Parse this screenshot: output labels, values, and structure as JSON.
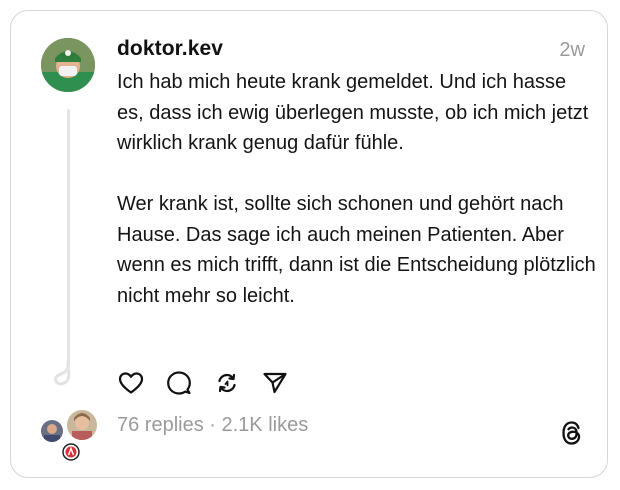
{
  "post": {
    "username": "doktor.kev",
    "timestamp": "2w",
    "paragraph_1": "Ich hab mich heute krank gemeldet. Und ich hasse es, dass ich ewig überlegen musste, ob ich mich jetzt wirklich krank genug dafür fühle.",
    "paragraph_2": "Wer krank ist, sollte sich schonen und gehört nach Hause. Das sage ich auch meinen Patienten. Aber wenn es mich trifft, dann ist die Entscheidung plötzlich nicht mehr so leicht."
  },
  "actions": [
    {
      "name": "like",
      "icon": "heart-icon"
    },
    {
      "name": "reply",
      "icon": "comment-icon"
    },
    {
      "name": "repost",
      "icon": "repost-icon"
    },
    {
      "name": "share",
      "icon": "send-icon"
    }
  ],
  "stats": {
    "summary": "76 replies · 2.1K likes"
  },
  "icons": {
    "app_logo": "threads-logo-icon"
  },
  "colors": {
    "text": "#141414",
    "muted": "#9a9a9a",
    "border": "#d6d6d6",
    "thread_line": "#e3e3e3"
  }
}
